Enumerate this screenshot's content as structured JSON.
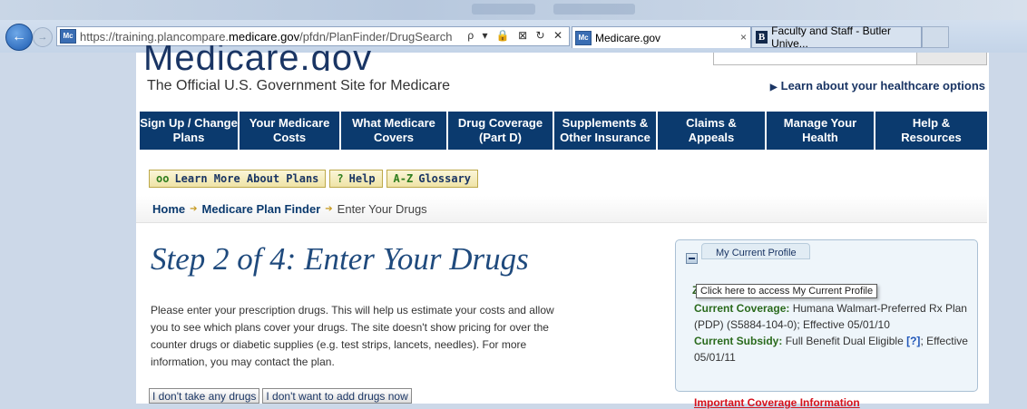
{
  "browser": {
    "address_url_prefix": "https://training.plancompare.",
    "address_url_domain": "medicare.gov",
    "address_url_path": "/pfdn/PlanFinder/DrugSearch",
    "address_icons": "ρ ▾ 🔒 ⊠ ↻ ✕",
    "favicon_text": "Mc",
    "tabs": [
      {
        "label": "Medicare.gov",
        "favicon": "Mc"
      },
      {
        "label": "Faculty and Staff - Butler Unive...",
        "favicon": "B"
      }
    ],
    "tab_close": "×"
  },
  "header": {
    "logo": "Medicare.gov",
    "tagline": "The Official U.S. Government Site for Medicare",
    "learn_link": "Learn about your healthcare options",
    "learn_arrow": "▶"
  },
  "nav": {
    "items": [
      {
        "line1": "Sign Up / Change",
        "line2": "Plans"
      },
      {
        "line1": "Your Medicare",
        "line2": "Costs"
      },
      {
        "line1": "What Medicare",
        "line2": "Covers"
      },
      {
        "line1": "Drug Coverage",
        "line2": "(Part D)"
      },
      {
        "line1": "Supplements &",
        "line2": "Other Insurance"
      },
      {
        "line1": "Claims &",
        "line2": "Appeals"
      },
      {
        "line1": "Manage Your",
        "line2": "Health"
      },
      {
        "line1": "Help &",
        "line2": "Resources"
      }
    ]
  },
  "toolbar": {
    "learn_more_icon": "oo",
    "learn_more": "Learn More About Plans",
    "help_icon": "?",
    "help": "Help",
    "glossary_icon": "A-Z",
    "glossary": "Glossary"
  },
  "breadcrumb": {
    "home": "Home",
    "plan_finder": "Medicare Plan Finder",
    "current": "Enter Your Drugs",
    "separator": "➔"
  },
  "main": {
    "title": "Step 2 of 4: Enter Your Drugs",
    "intro": "Please enter your prescription drugs. This will help us estimate your costs and allow you to see which plans cover your drugs. The site doesn't show pricing for over the counter drugs or diabetic supplies (e.g. test strips, lancets, needles). For more information, you may contact the plan.",
    "btn_no_drugs": "I don't take any drugs",
    "btn_no_add": "I don't want to add drugs now"
  },
  "profile": {
    "tab_label": "My Current Profile",
    "tooltip": "Click here to access My Current Profile",
    "zip_initial": "Z",
    "coverage_label": "Current Coverage:",
    "coverage_value": "Humana Walmart-Preferred Rx Plan (PDP) (S5884-104-0); Effective 05/01/10",
    "subsidy_label": "Current Subsidy:",
    "subsidy_value_pre": "Full Benefit Dual Eligible",
    "subsidy_q": "[?]",
    "subsidy_value_post": "; Effective 05/01/11",
    "important_link": "Important Coverage Information"
  }
}
